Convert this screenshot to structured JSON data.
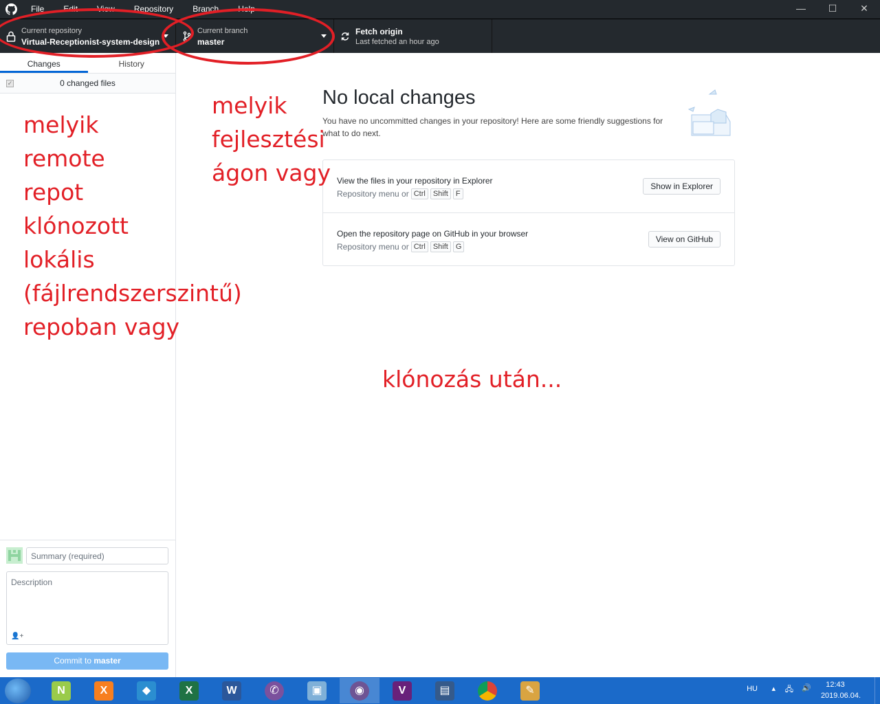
{
  "menu": [
    "File",
    "Edit",
    "View",
    "Repository",
    "Branch",
    "Help"
  ],
  "window_controls": {
    "minimize": "—",
    "maximize": "☐",
    "close": "✕"
  },
  "toolbar": {
    "repo_label": "Current repository",
    "repo_name": "Virtual-Receptionist-system-design",
    "branch_label": "Current branch",
    "branch_name": "master",
    "fetch_label": "Fetch origin",
    "fetch_status": "Last fetched an hour ago"
  },
  "sidebar": {
    "tabs": [
      "Changes",
      "History"
    ],
    "changed_files": "0 changed files",
    "summary_placeholder": "Summary (required)",
    "description_placeholder": "Description",
    "commit_prefix": "Commit to ",
    "commit_branch": "master"
  },
  "main": {
    "title": "No local changes",
    "subtitle": "You have no uncommitted changes in your repository! Here are some friendly suggestions for what to do next.",
    "suggestions": [
      {
        "title": "View the files in your repository in Explorer",
        "hint": "Repository menu or",
        "keys": [
          "Ctrl",
          "Shift",
          "F"
        ],
        "button": "Show in Explorer"
      },
      {
        "title": "Open the repository page on GitHub in your browser",
        "hint": "Repository menu or",
        "keys": [
          "Ctrl",
          "Shift",
          "G"
        ],
        "button": "View on GitHub"
      }
    ]
  },
  "annotations": {
    "left": [
      "melyik",
      "remote",
      "repot",
      "klónozott",
      "lokális",
      "(fájlrendszerszintű)",
      "repoban vagy"
    ],
    "middle": [
      "melyik",
      "fejlesztési",
      "ágon vagy"
    ],
    "bottom": "klónozás után..."
  },
  "taskbar": {
    "apps": [
      "notepad-plus-plus",
      "xampp",
      "sourcetree",
      "excel",
      "word",
      "viber",
      "virtualbox",
      "github-desktop",
      "visual-studio",
      "save-app",
      "chrome",
      "paint"
    ],
    "language": "HU",
    "time": "12:43",
    "date": "2019.06.04."
  },
  "colors": {
    "annotation_red": "#e21f26",
    "toolbar_bg": "#24292e",
    "accent_blue": "#0366d6",
    "commit_button": "#79b8f4",
    "taskbar": "#1b6ac9"
  }
}
